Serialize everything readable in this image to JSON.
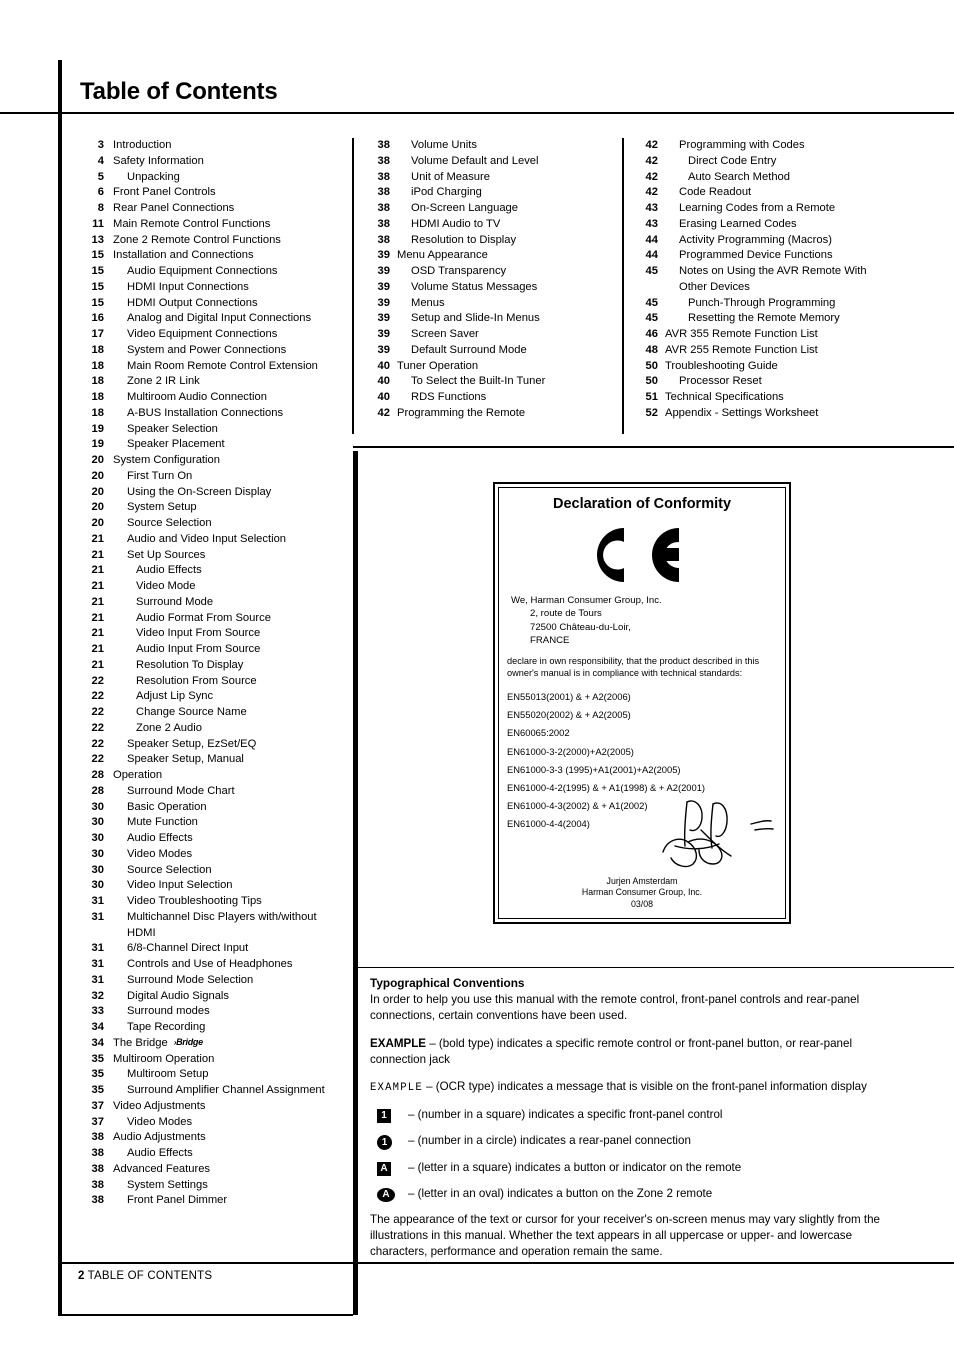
{
  "page": {
    "title": "Table of Contents",
    "footer_number": "2",
    "footer_label": "TABLE OF CONTENTS"
  },
  "toc": {
    "column1": [
      {
        "num": "3",
        "label": "Introduction",
        "level": 0
      },
      {
        "num": "4",
        "label": "Safety Information",
        "level": 0
      },
      {
        "num": "5",
        "label": "Unpacking",
        "level": 1
      },
      {
        "num": "6",
        "label": "Front Panel Controls",
        "level": 0
      },
      {
        "num": "8",
        "label": "Rear Panel Connections",
        "level": 0
      },
      {
        "num": "11",
        "label": "Main Remote Control Functions",
        "level": 0
      },
      {
        "num": "13",
        "label": "Zone 2 Remote Control Functions",
        "level": 0
      },
      {
        "num": "15",
        "label": "Installation and Connections",
        "level": 0
      },
      {
        "num": "15",
        "label": "Audio Equipment Connections",
        "level": 1
      },
      {
        "num": "15",
        "label": "HDMI Input Connections",
        "level": 1
      },
      {
        "num": "15",
        "label": "HDMI Output Connections",
        "level": 1
      },
      {
        "num": "16",
        "label": "Analog and Digital Input Connections",
        "level": 1
      },
      {
        "num": "17",
        "label": "Video Equipment Connections",
        "level": 1
      },
      {
        "num": "18",
        "label": "System and Power Connections",
        "level": 1
      },
      {
        "num": "18",
        "label": "Main Room Remote Control Extension",
        "level": 1
      },
      {
        "num": "18",
        "label": "Zone 2 IR Link",
        "level": 1
      },
      {
        "num": "18",
        "label": "Multiroom Audio Connection",
        "level": 1
      },
      {
        "num": "18",
        "label": "A-BUS Installation Connections",
        "level": 1
      },
      {
        "num": "19",
        "label": "Speaker Selection",
        "level": 1
      },
      {
        "num": "19",
        "label": "Speaker Placement",
        "level": 1
      },
      {
        "num": "20",
        "label": "System Configuration",
        "level": 0
      },
      {
        "num": "20",
        "label": "First Turn On",
        "level": 1
      },
      {
        "num": "20",
        "label": "Using the On-Screen Display",
        "level": 1
      },
      {
        "num": "20",
        "label": "System Setup",
        "level": 1
      },
      {
        "num": "20",
        "label": "Source Selection",
        "level": 1
      },
      {
        "num": "21",
        "label": "Audio and Video Input Selection",
        "level": 1
      },
      {
        "num": "21",
        "label": "Set Up Sources",
        "level": 1
      },
      {
        "num": "21",
        "label": "Audio Effects",
        "level": 2
      },
      {
        "num": "21",
        "label": "Video Mode",
        "level": 2
      },
      {
        "num": "21",
        "label": "Surround Mode",
        "level": 2
      },
      {
        "num": "21",
        "label": "Audio Format From Source",
        "level": 2
      },
      {
        "num": "21",
        "label": "Video Input From Source",
        "level": 2
      },
      {
        "num": "21",
        "label": "Audio Input From Source",
        "level": 2
      },
      {
        "num": "21",
        "label": "Resolution To Display",
        "level": 2
      },
      {
        "num": "22",
        "label": "Resolution From Source",
        "level": 2
      },
      {
        "num": "22",
        "label": "Adjust Lip Sync",
        "level": 2
      },
      {
        "num": "22",
        "label": "Change Source Name",
        "level": 2
      },
      {
        "num": "22",
        "label": "Zone 2 Audio",
        "level": 2
      },
      {
        "num": "22",
        "label": "Speaker Setup, EzSet/EQ",
        "level": 1
      },
      {
        "num": "22",
        "label": "Speaker Setup, Manual",
        "level": 1
      },
      {
        "num": "28",
        "label": "Operation",
        "level": 0
      },
      {
        "num": "28",
        "label": "Surround Mode Chart",
        "level": 1
      },
      {
        "num": "30",
        "label": "Basic Operation",
        "level": 1
      },
      {
        "num": "30",
        "label": "Mute Function",
        "level": 1
      },
      {
        "num": "30",
        "label": "Audio Effects",
        "level": 1
      },
      {
        "num": "30",
        "label": "Video Modes",
        "level": 1
      },
      {
        "num": "30",
        "label": "Source Selection",
        "level": 1
      },
      {
        "num": "30",
        "label": "Video Input Selection",
        "level": 1
      },
      {
        "num": "31",
        "label": "Video Troubleshooting Tips",
        "level": 1
      },
      {
        "num": "31",
        "label": "Multichannel Disc Players with/without",
        "level": 1,
        "cont": "HDMI"
      },
      {
        "num": "31",
        "label": "6/8-Channel Direct Input",
        "level": 1
      },
      {
        "num": "31",
        "label": "Controls and Use of Headphones",
        "level": 1
      },
      {
        "num": "31",
        "label": "Surround Mode Selection",
        "level": 1
      },
      {
        "num": "32",
        "label": "Digital Audio Signals",
        "level": 1
      },
      {
        "num": "33",
        "label": "Surround modes",
        "level": 1
      },
      {
        "num": "34",
        "label": "Tape Recording",
        "level": 1
      },
      {
        "num": "34",
        "label": "The Bridge",
        "level": 0,
        "logo": "Bridge"
      },
      {
        "num": "35",
        "label": "Multiroom Operation",
        "level": 0
      },
      {
        "num": "35",
        "label": "Multiroom Setup",
        "level": 1
      },
      {
        "num": "35",
        "label": "Surround Amplifier Channel Assignment",
        "level": 1
      },
      {
        "num": "37",
        "label": "Video Adjustments",
        "level": 0
      },
      {
        "num": "37",
        "label": "Video Modes",
        "level": 1
      },
      {
        "num": "38",
        "label": "Audio Adjustments",
        "level": 0
      },
      {
        "num": "38",
        "label": "Audio Effects",
        "level": 1
      },
      {
        "num": "38",
        "label": "Advanced Features",
        "level": 0
      },
      {
        "num": "38",
        "label": "System Settings",
        "level": 1
      },
      {
        "num": "38",
        "label": "Front Panel Dimmer",
        "level": 1
      }
    ],
    "column2": [
      {
        "num": "38",
        "label": "Volume Units",
        "level": 1
      },
      {
        "num": "38",
        "label": "Volume Default and Level",
        "level": 1
      },
      {
        "num": "38",
        "label": "Unit of Measure",
        "level": 1
      },
      {
        "num": "38",
        "label": "iPod Charging",
        "level": 1
      },
      {
        "num": "38",
        "label": "On-Screen Language",
        "level": 1
      },
      {
        "num": "38",
        "label": "HDMI Audio to TV",
        "level": 1
      },
      {
        "num": "38",
        "label": "Resolution to Display",
        "level": 1
      },
      {
        "num": "39",
        "label": "Menu Appearance",
        "level": 0
      },
      {
        "num": "39",
        "label": "OSD Transparency",
        "level": 1
      },
      {
        "num": "39",
        "label": "Volume Status Messages",
        "level": 1
      },
      {
        "num": "39",
        "label": "Menus",
        "level": 1
      },
      {
        "num": "39",
        "label": "Setup and Slide-In Menus",
        "level": 1
      },
      {
        "num": "39",
        "label": "Screen Saver",
        "level": 1
      },
      {
        "num": "39",
        "label": "Default Surround Mode",
        "level": 1
      },
      {
        "num": "40",
        "label": "Tuner Operation",
        "level": 0
      },
      {
        "num": "40",
        "label": "To Select the Built-In Tuner",
        "level": 1
      },
      {
        "num": "40",
        "label": "RDS Functions",
        "level": 1
      },
      {
        "num": "42",
        "label": "Programming the Remote",
        "level": 0
      }
    ],
    "column3": [
      {
        "num": "42",
        "label": "Programming with Codes",
        "level": 1
      },
      {
        "num": "42",
        "label": "Direct Code Entry",
        "level": 2
      },
      {
        "num": "42",
        "label": "Auto Search Method",
        "level": 2
      },
      {
        "num": "42",
        "label": "Code Readout",
        "level": 1
      },
      {
        "num": "43",
        "label": "Learning Codes from a Remote",
        "level": 1
      },
      {
        "num": "43",
        "label": "Erasing Learned Codes",
        "level": 1
      },
      {
        "num": "44",
        "label": "Activity Programming (Macros)",
        "level": 1
      },
      {
        "num": "44",
        "label": "Programmed Device Functions",
        "level": 1
      },
      {
        "num": "45",
        "label": "Notes on Using the AVR Remote With",
        "level": 1,
        "cont": "Other Devices"
      },
      {
        "num": "45",
        "label": "Punch-Through Programming",
        "level": 2
      },
      {
        "num": "45",
        "label": "Resetting the Remote Memory",
        "level": 2
      },
      {
        "num": "46",
        "label": "AVR 355 Remote Function List",
        "level": 0
      },
      {
        "num": "48",
        "label": "AVR 255 Remote Function List",
        "level": 0
      },
      {
        "num": "50",
        "label": "Troubleshooting Guide",
        "level": 0
      },
      {
        "num": "50",
        "label": "Processor Reset",
        "level": 1
      },
      {
        "num": "51",
        "label": "Technical Specifications",
        "level": 0
      },
      {
        "num": "52",
        "label": "Appendix - Settings Worksheet",
        "level": 0
      }
    ]
  },
  "declaration": {
    "title": "Declaration of Conformity",
    "ce_mark": "CE",
    "company_line": "We, Harman Consumer Group, Inc.",
    "address_line1": "2, route de Tours",
    "address_line2": "72500 Château-du-Loir,",
    "address_line3": "FRANCE",
    "declare_text": "declare in own responsibility, that the product described in this owner's manual is in compliance with technical standards:",
    "standards": [
      "EN55013(2001) & + A2(2006)",
      "EN55020(2002) & + A2(2005)",
      "EN60065:2002",
      "EN61000-3-2(2000)+A2(2005)",
      "EN61000-3-3 (1995)+A1(2001)+A2(2005)",
      "EN61000-4-2(1995) & + A1(1998) & + A2(2001)",
      "EN61000-4-3(2002) & + A1(2002)",
      "EN61000-4-4(2004)"
    ],
    "signer_name": "Jurjen Amsterdam",
    "signer_company": "Harman Consumer Group, Inc.",
    "signer_date": "03/08"
  },
  "typographical": {
    "heading": "Typographical Conventions",
    "intro": "In order to help you use this manual with the remote control, front-panel controls and rear-panel connections, certain conventions have been used.",
    "example_bold_term": "EXAMPLE",
    "example_bold_text": " – (bold type) indicates a specific remote control or front-panel button, or rear-panel connection jack",
    "example_ocr_term": "EXAMPLE",
    "example_ocr_text": " – (OCR type) indicates a message that is visible on the front-panel information display",
    "bullets": [
      {
        "glyph": "1",
        "shape": "square",
        "text": "– (number in a square) indicates a specific front-panel control"
      },
      {
        "glyph": "1",
        "shape": "circle",
        "text": "– (number in a circle) indicates a rear-panel connection"
      },
      {
        "glyph": "A",
        "shape": "square",
        "text": "– (letter in a square) indicates a button or indicator on the remote"
      },
      {
        "glyph": "A",
        "shape": "oval",
        "text": "– (letter in an oval) indicates a button on the Zone 2 remote"
      }
    ],
    "closing": "The appearance of the text or cursor for your receiver's on-screen menus may vary slightly from the illustrations in this manual. Whether the text appears in all uppercase or upper- and lowercase characters, performance and operation remain the same."
  }
}
